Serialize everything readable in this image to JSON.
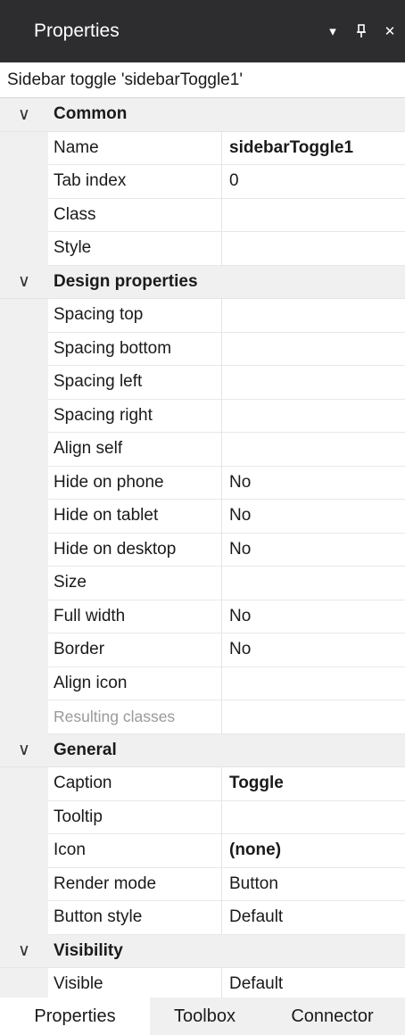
{
  "panel": {
    "title": "Properties",
    "dropdown_glyph": "▾",
    "pin_glyph": "⊥",
    "close_glyph": "✕"
  },
  "subtitle": "Sidebar toggle 'sidebarToggle1'",
  "chevron": "∨",
  "categories": [
    {
      "label": "Common",
      "props": [
        {
          "name": "Name",
          "value": "sidebarToggle1",
          "bold": true
        },
        {
          "name": "Tab index",
          "value": "0"
        },
        {
          "name": "Class",
          "value": ""
        },
        {
          "name": "Style",
          "value": ""
        }
      ]
    },
    {
      "label": "Design properties",
      "props": [
        {
          "name": "Spacing top",
          "value": ""
        },
        {
          "name": "Spacing bottom",
          "value": ""
        },
        {
          "name": "Spacing left",
          "value": ""
        },
        {
          "name": "Spacing right",
          "value": ""
        },
        {
          "name": "Align self",
          "value": ""
        },
        {
          "name": "Hide on phone",
          "value": "No"
        },
        {
          "name": "Hide on tablet",
          "value": "No"
        },
        {
          "name": "Hide on desktop",
          "value": "No"
        },
        {
          "name": "Size",
          "value": ""
        },
        {
          "name": "Full width",
          "value": "No"
        },
        {
          "name": "Border",
          "value": "No"
        },
        {
          "name": "Align icon",
          "value": ""
        },
        {
          "name": "Resulting classes",
          "value": "",
          "disabled": true
        }
      ]
    },
    {
      "label": "General",
      "props": [
        {
          "name": "Caption",
          "value": "Toggle",
          "bold": true
        },
        {
          "name": "Tooltip",
          "value": ""
        },
        {
          "name": "Icon",
          "value": "(none)",
          "bold": true
        },
        {
          "name": "Render mode",
          "value": "Button"
        },
        {
          "name": "Button style",
          "value": "Default"
        }
      ]
    },
    {
      "label": "Visibility",
      "props": [
        {
          "name": "Visible",
          "value": "Default"
        }
      ]
    }
  ],
  "tabs": [
    "Properties",
    "Toolbox",
    "Connector"
  ]
}
